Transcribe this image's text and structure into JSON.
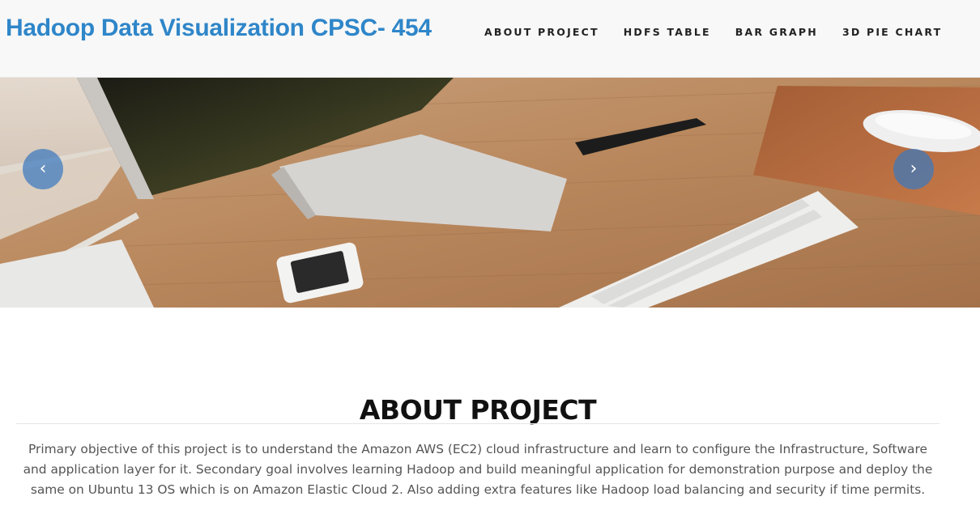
{
  "header": {
    "brand": "Hadoop Data Visualization CPSC- 454",
    "nav": [
      {
        "label": "ABOUT PROJECT"
      },
      {
        "label": "HDFS TABLE"
      },
      {
        "label": "BAR GRAPH"
      },
      {
        "label": "3D PIE CHART"
      }
    ]
  },
  "carousel": {
    "prev_icon": "chevron-left-icon",
    "next_icon": "chevron-right-icon",
    "prev_glyph": "‹",
    "next_glyph": "›"
  },
  "about": {
    "title": "ABOUT PROJECT",
    "body": "Primary objective of this project is to understand the Amazon AWS (EC2) cloud infrastructure and learn to configure the Infrastructure, Software and application layer for it. Secondary goal involves learning Hadoop and build meaningful application for demonstration purpose and deploy the same on Ubuntu 13 OS which is on Amazon Elastic Cloud 2. Also adding extra features like Hadoop load balancing and security if time permits."
  },
  "colors": {
    "brand": "#2f86c9",
    "navbar_bg": "#f8f8f8",
    "carousel_button": "#3c78be"
  }
}
